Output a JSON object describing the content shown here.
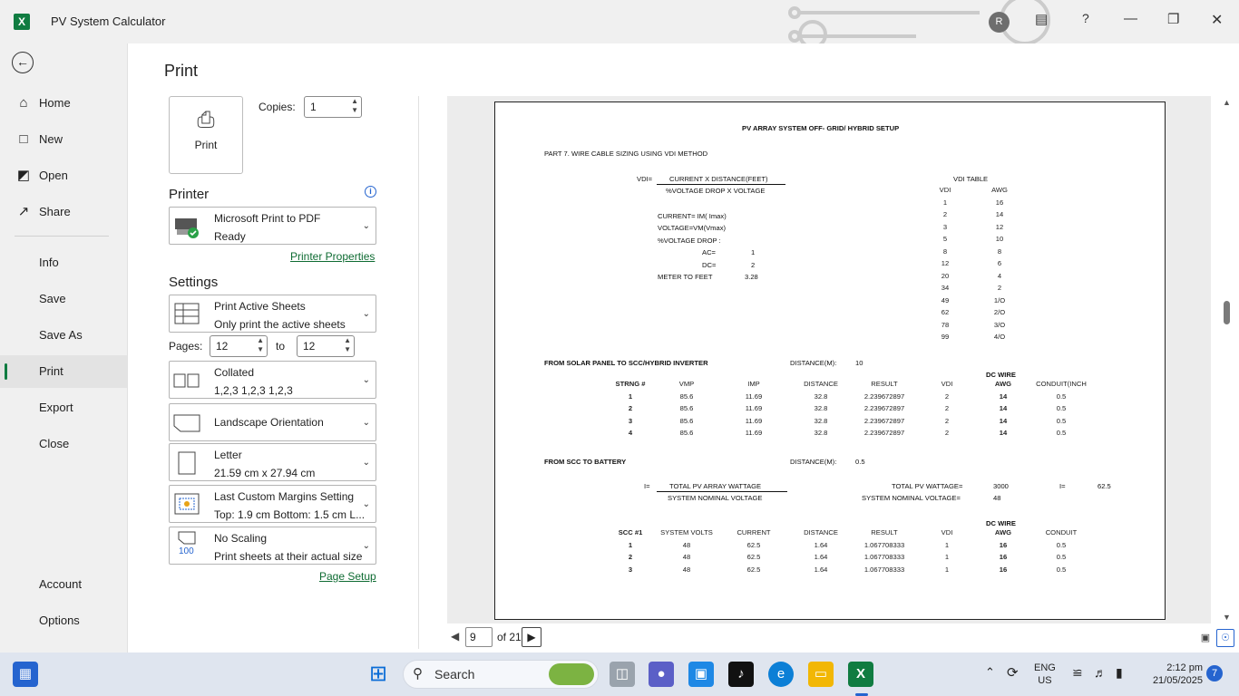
{
  "window": {
    "title": "PV System Calculator",
    "user_initial": "R"
  },
  "sidebar": {
    "items": [
      {
        "label": "Home",
        "icon": "home-icon"
      },
      {
        "label": "New",
        "icon": "new-doc-icon"
      },
      {
        "label": "Open",
        "icon": "folder-icon"
      },
      {
        "label": "Share",
        "icon": "share-icon"
      },
      {
        "label": "Info"
      },
      {
        "label": "Save"
      },
      {
        "label": "Save As"
      },
      {
        "label": "Print",
        "active": true
      },
      {
        "label": "Export"
      },
      {
        "label": "Close"
      }
    ],
    "bottom": [
      {
        "label": "Account"
      },
      {
        "label": "Options"
      }
    ]
  },
  "print": {
    "heading": "Print",
    "button_label": "Print",
    "copies_label": "Copies:",
    "copies_value": "1",
    "printer_heading": "Printer",
    "printer_name": "Microsoft Print to PDF",
    "printer_status": "Ready",
    "printer_properties": "Printer Properties",
    "settings_heading": "Settings",
    "settings": [
      {
        "line1": "Print Active Sheets",
        "line2": "Only print the active sheets"
      },
      {
        "line1": "Collated",
        "line2": "1,2,3    1,2,3    1,2,3"
      },
      {
        "line1": "Landscape Orientation",
        "line2": ""
      },
      {
        "line1": "Letter",
        "line2": "21.59 cm x 27.94 cm"
      },
      {
        "line1": "Last Custom Margins Setting",
        "line2": "Top: 1.9 cm Bottom: 1.5 cm L..."
      },
      {
        "line1": "No Scaling",
        "line2": "Print sheets at their actual size"
      }
    ],
    "pages_label": "Pages:",
    "pages_from": "12",
    "pages_to_label": "to",
    "pages_to": "12",
    "page_setup": "Page Setup",
    "scaling_badge": "100"
  },
  "preview": {
    "current_page": "9",
    "of_pages": "of 21",
    "sheet": {
      "title": "PV ARRAY SYSTEM OFF- GRID/ HYBRID SETUP",
      "part": "PART 7. WIRE CABLE SIZING USING VDI METHOD",
      "vdi_eq": "VDI=",
      "vdi_num": "CURRENT X DISTANCE(FEET)",
      "vdi_den": "%VOLTAGE DROP X VOLTAGE",
      "defs": [
        {
          "k": "CURRENT= IM( Imax)",
          "v": ""
        },
        {
          "k": "VOLTAGE=VM(Vmax)",
          "v": ""
        },
        {
          "k": "%VOLTAGE DROP :",
          "v": ""
        }
      ],
      "ac_label": "AC=",
      "ac_value": "1",
      "dc_label": "DC=",
      "dc_value": "2",
      "meter_label": "METER TO FEET",
      "meter_value": "3.28",
      "vdi_table_title": "VDI TABLE",
      "vdi_table_head": [
        "VDI",
        "AWG"
      ],
      "vdi_table": [
        [
          "1",
          "16"
        ],
        [
          "2",
          "14"
        ],
        [
          "3",
          "12"
        ],
        [
          "5",
          "10"
        ],
        [
          "8",
          "8"
        ],
        [
          "12",
          "6"
        ],
        [
          "20",
          "4"
        ],
        [
          "34",
          "2"
        ],
        [
          "49",
          "1/O"
        ],
        [
          "62",
          "2/O"
        ],
        [
          "78",
          "3/O"
        ],
        [
          "99",
          "4/O"
        ]
      ],
      "sec1_title": "FROM SOLAR PANEL TO SCC/HYBRID INVERTER",
      "sec1_dist_label": "DISTANCE(M):",
      "sec1_dist": "10",
      "sec1_dcwire": "DC WIRE",
      "sec1_head": [
        "STRNG #",
        "VMP",
        "IMP",
        "DISTANCE",
        "RESULT",
        "VDI",
        "AWG",
        "CONDUIT(INCH"
      ],
      "sec1_rows": [
        [
          "1",
          "85.6",
          "11.69",
          "32.8",
          "2.239672897",
          "2",
          "14",
          "0.5"
        ],
        [
          "2",
          "85.6",
          "11.69",
          "32.8",
          "2.239672897",
          "2",
          "14",
          "0.5"
        ],
        [
          "3",
          "85.6",
          "11.69",
          "32.8",
          "2.239672897",
          "2",
          "14",
          "0.5"
        ],
        [
          "4",
          "85.6",
          "11.69",
          "32.8",
          "2.239672897",
          "2",
          "14",
          "0.5"
        ]
      ],
      "sec2_title": "FROM SCC TO BATTERY",
      "sec2_dist_label": "DISTANCE(M):",
      "sec2_dist": "0.5",
      "i_eq": "I=",
      "i_num": "TOTAL PV ARRAY WATTAGE",
      "i_den": "SYSTEM NOMINAL VOLTAGE",
      "tw_label": "TOTAL PV WATTAGE=",
      "tw_value": "3000",
      "i_label": "I=",
      "i_value": "62.5",
      "snv_label": "SYSTEM NOMINAL VOLTAGE=",
      "snv_value": "48",
      "sec2_dcwire": "DC WIRE",
      "sec2_head": [
        "SCC #1",
        "SYSTEM VOLTS",
        "CURRENT",
        "DISTANCE",
        "RESULT",
        "VDI",
        "AWG",
        "CONDUIT"
      ],
      "sec2_rows": [
        [
          "1",
          "48",
          "62.5",
          "1.64",
          "1.067708333",
          "1",
          "16",
          "0.5"
        ],
        [
          "2",
          "48",
          "62.5",
          "1.64",
          "1.067708333",
          "1",
          "16",
          "0.5"
        ],
        [
          "3",
          "48",
          "62.5",
          "1.64",
          "1.067708333",
          "1",
          "16",
          "0.5"
        ]
      ]
    }
  },
  "taskbar": {
    "search_label": "Search",
    "lang1": "ENG",
    "lang2": "US",
    "time": "2:12 pm",
    "date": "21/05/2025",
    "notif_count": "7"
  },
  "colors": {
    "accent": "#107c41",
    "link": "#0e6b32",
    "info": "#2564cf"
  }
}
